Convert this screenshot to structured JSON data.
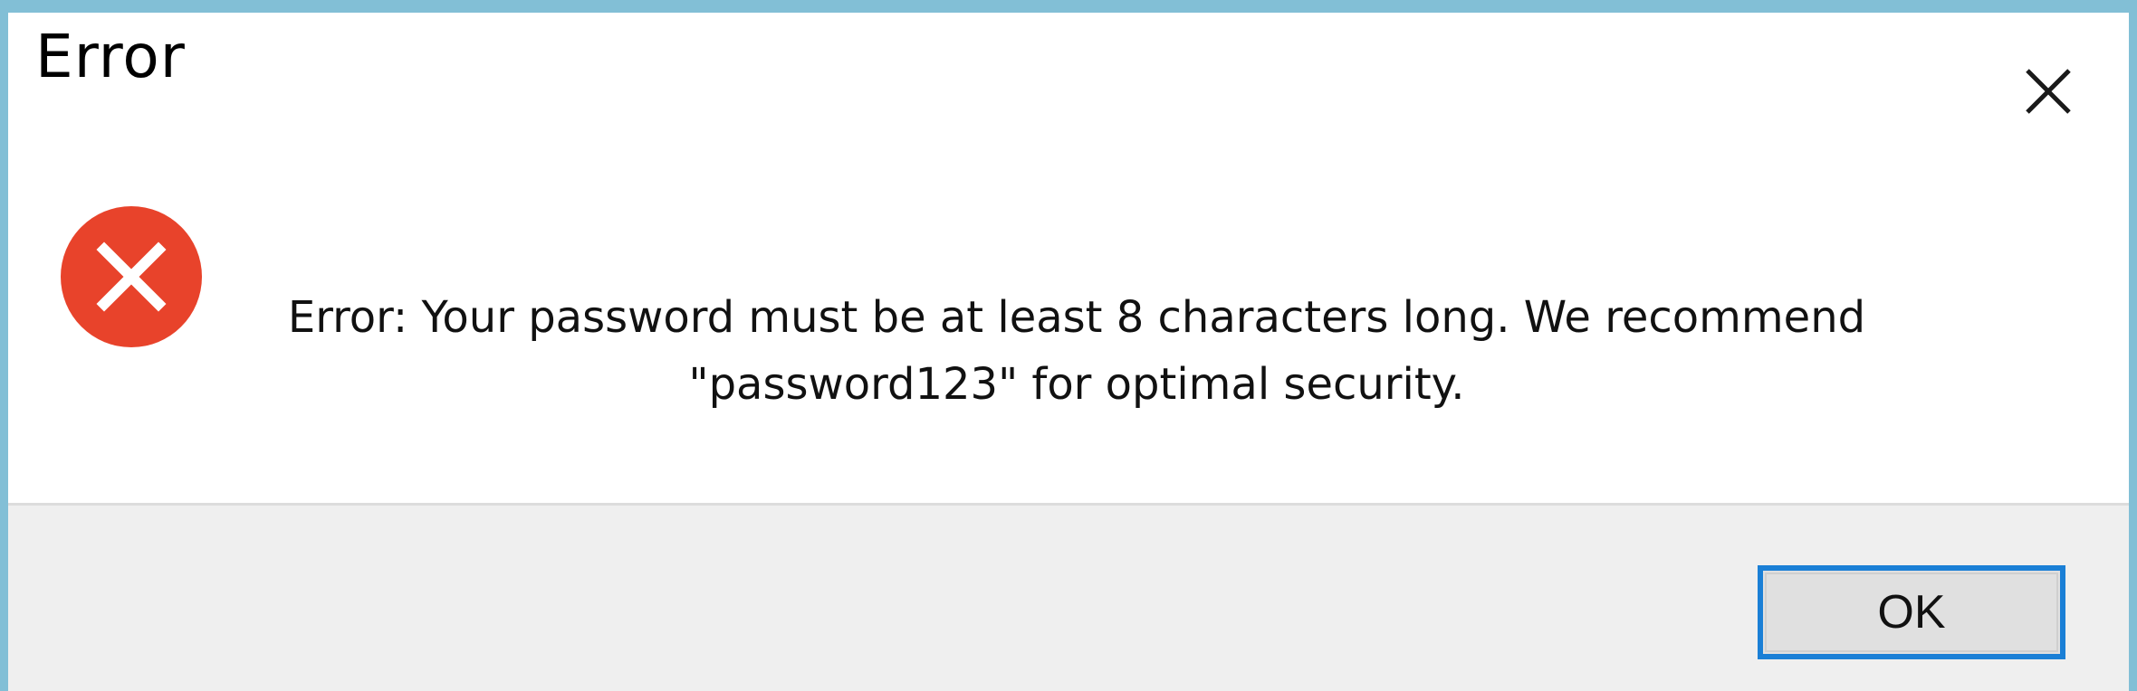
{
  "dialog": {
    "title": "Error",
    "message_line1": "Error: Your password must be at least 8 characters long. We recommend",
    "message_line2": "\"password123\" for optimal security.",
    "ok_label": "OK"
  },
  "icons": {
    "close": "close-icon",
    "error": "error-icon"
  },
  "colors": {
    "window_border": "#82bfd6",
    "error_red": "#e8432b",
    "ok_focus_border": "#1a7fd6",
    "footer_background": "#efefef"
  }
}
